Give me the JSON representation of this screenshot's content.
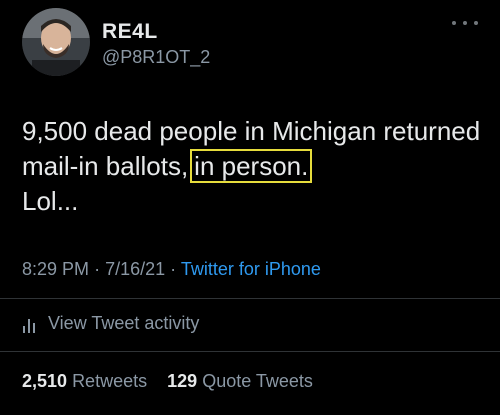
{
  "user": {
    "display_name": "RE4L",
    "handle": "@P8R1OT_2"
  },
  "tweet": {
    "text_before": "9,500 dead people in Michigan returned mail-in ballots,",
    "text_highlighted": "in person.",
    "text_after": "Lol...",
    "highlight_color": "#e6dc3c"
  },
  "meta": {
    "time": "8:29 PM",
    "separator1": "·",
    "date": "7/16/21",
    "separator2": "·",
    "source": "Twitter for iPhone",
    "source_color": "#2f9af0"
  },
  "activity": {
    "label": "View Tweet activity",
    "icon": "bar-chart-icon"
  },
  "stats": {
    "retweets_count": "2,510",
    "retweets_label": "Retweets",
    "quotes_count": "129",
    "quotes_label": "Quote Tweets"
  },
  "menu_icon": "more-icon"
}
